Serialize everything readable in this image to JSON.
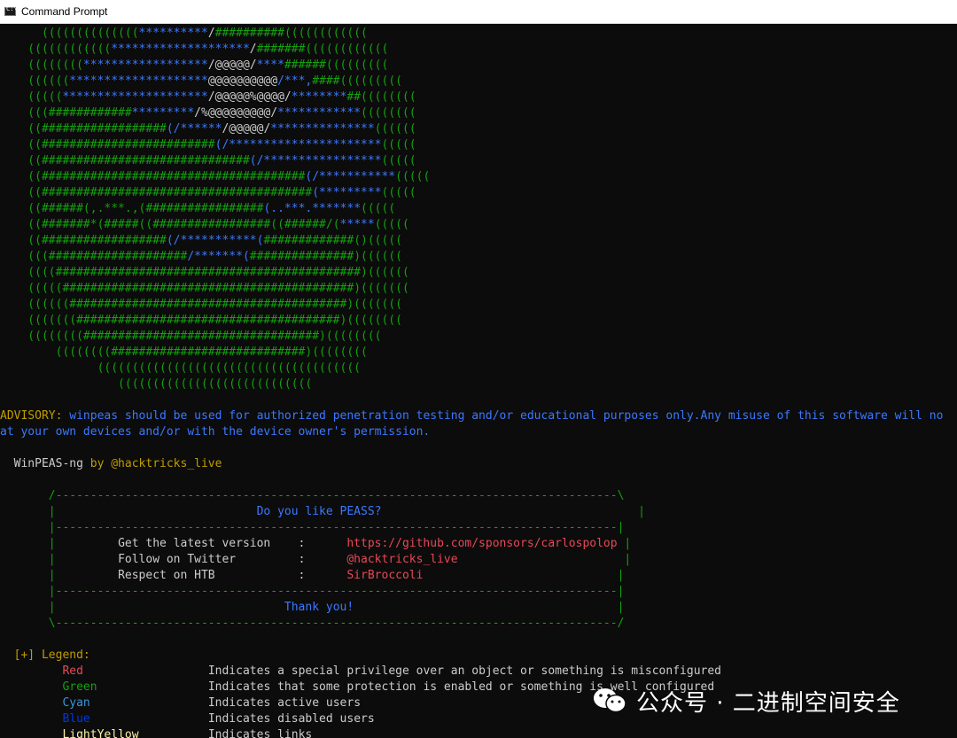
{
  "window": {
    "title": "Command Prompt",
    "icon": "cmd-icon"
  },
  "art": [
    [
      {
        "t": "      ((((((((((((((",
        "c": "g"
      },
      {
        "t": "**********",
        "c": "b"
      },
      {
        "t": "/",
        "c": "w"
      },
      {
        "t": "##########",
        "c": "g"
      },
      {
        "t": "((((((((((((",
        "c": "g"
      }
    ],
    [
      {
        "t": "    ((((((((((((",
        "c": "g"
      },
      {
        "t": "********************",
        "c": "b"
      },
      {
        "t": "/",
        "c": "w"
      },
      {
        "t": "#######",
        "c": "g"
      },
      {
        "t": "((((((((((((",
        "c": "g"
      }
    ],
    [
      {
        "t": "    ((((((((",
        "c": "g"
      },
      {
        "t": "******************",
        "c": "b"
      },
      {
        "t": "/@@@@@/",
        "c": "w"
      },
      {
        "t": "****",
        "c": "b"
      },
      {
        "t": "######",
        "c": "g"
      },
      {
        "t": "(((((((((",
        "c": "g"
      }
    ],
    [
      {
        "t": "    ((((((",
        "c": "g"
      },
      {
        "t": "********************",
        "c": "b"
      },
      {
        "t": "@@@@@@@@@@",
        "c": "w"
      },
      {
        "t": "/***,",
        "c": "b"
      },
      {
        "t": "####",
        "c": "g"
      },
      {
        "t": "(((((((((",
        "c": "g"
      }
    ],
    [
      {
        "t": "    (((((",
        "c": "g"
      },
      {
        "t": "*********************",
        "c": "b"
      },
      {
        "t": "/@@@@@%@@@@/",
        "c": "w"
      },
      {
        "t": "********",
        "c": "b"
      },
      {
        "t": "##",
        "c": "g"
      },
      {
        "t": "((((((((",
        "c": "g"
      }
    ],
    [
      {
        "t": "    (((",
        "c": "g"
      },
      {
        "t": "############",
        "c": "g"
      },
      {
        "t": "*********",
        "c": "b"
      },
      {
        "t": "/%@@@@@@@@@/",
        "c": "w"
      },
      {
        "t": "************",
        "c": "b"
      },
      {
        "t": "((((((((",
        "c": "g"
      }
    ],
    [
      {
        "t": "    ((",
        "c": "g"
      },
      {
        "t": "##################",
        "c": "g"
      },
      {
        "t": "(/******",
        "c": "b"
      },
      {
        "t": "/@@@@@/",
        "c": "w"
      },
      {
        "t": "***************",
        "c": "b"
      },
      {
        "t": "((((((",
        "c": "g"
      }
    ],
    [
      {
        "t": "    ((",
        "c": "g"
      },
      {
        "t": "#########################",
        "c": "g"
      },
      {
        "t": "(/**********************",
        "c": "b"
      },
      {
        "t": "(((((",
        "c": "g"
      }
    ],
    [
      {
        "t": "    ((",
        "c": "g"
      },
      {
        "t": "##############################",
        "c": "g"
      },
      {
        "t": "(/*****************",
        "c": "b"
      },
      {
        "t": "(((((",
        "c": "g"
      }
    ],
    [
      {
        "t": "    ((",
        "c": "g"
      },
      {
        "t": "######################################",
        "c": "g"
      },
      {
        "t": "(/***********",
        "c": "b"
      },
      {
        "t": "(((((",
        "c": "g"
      }
    ],
    [
      {
        "t": "    ((",
        "c": "g"
      },
      {
        "t": "#######################################",
        "c": "g"
      },
      {
        "t": "(*********",
        "c": "b"
      },
      {
        "t": "(((((",
        "c": "g"
      }
    ],
    [
      {
        "t": "    ((",
        "c": "g"
      },
      {
        "t": "######(,.***.,(",
        "c": "g"
      },
      {
        "t": "#################",
        "c": "g"
      },
      {
        "t": "(..***.",
        "c": "b"
      },
      {
        "t": "*******",
        "c": "b"
      },
      {
        "t": "(((((",
        "c": "g"
      }
    ],
    [
      {
        "t": "    ((",
        "c": "g"
      },
      {
        "t": "#######*(#####((",
        "c": "g"
      },
      {
        "t": "#################",
        "c": "g"
      },
      {
        "t": "((######/(",
        "c": "g"
      },
      {
        "t": "*****",
        "c": "b"
      },
      {
        "t": "(((((",
        "c": "g"
      }
    ],
    [
      {
        "t": "    ((",
        "c": "g"
      },
      {
        "t": "##################",
        "c": "g"
      },
      {
        "t": "(/***********(",
        "c": "b"
      },
      {
        "t": "#############",
        "c": "g"
      },
      {
        "t": "()(((((",
        "c": "g"
      }
    ],
    [
      {
        "t": "    (((",
        "c": "g"
      },
      {
        "t": "####################",
        "c": "g"
      },
      {
        "t": "/*******(",
        "c": "b"
      },
      {
        "t": "###############",
        "c": "g"
      },
      {
        "t": ")((((((",
        "c": "g"
      }
    ],
    [
      {
        "t": "    ((((",
        "c": "g"
      },
      {
        "t": "############################################",
        "c": "g"
      },
      {
        "t": ")((((((",
        "c": "g"
      }
    ],
    [
      {
        "t": "    (((((",
        "c": "g"
      },
      {
        "t": "##########################################",
        "c": "g"
      },
      {
        "t": ")(((((((",
        "c": "g"
      }
    ],
    [
      {
        "t": "    ((((((",
        "c": "g"
      },
      {
        "t": "########################################",
        "c": "g"
      },
      {
        "t": ")(((((((",
        "c": "g"
      }
    ],
    [
      {
        "t": "    (((((((",
        "c": "g"
      },
      {
        "t": "######################################",
        "c": "g"
      },
      {
        "t": ")((((((((",
        "c": "g"
      }
    ],
    [
      {
        "t": "    ((((((((",
        "c": "g"
      },
      {
        "t": "##################################",
        "c": "g"
      },
      {
        "t": ")((((((((",
        "c": "g"
      }
    ],
    [
      {
        "t": "        ((((((((",
        "c": "g"
      },
      {
        "t": "############################",
        "c": "g"
      },
      {
        "t": ")((((((((",
        "c": "g"
      }
    ],
    [
      {
        "t": "              ((((((((((((((((((((((((((((((((((((((",
        "c": "g"
      }
    ],
    [
      {
        "t": "                 ((((((((((((((((((((((((((((",
        "c": "g"
      }
    ]
  ],
  "advisory": {
    "label": "ADVISORY:",
    "text1": " winpeas should be used for authorized penetration testing and/or educational purposes only.Any misuse of this software will no",
    "text2": "at your own devices and/or with the device owner's permission."
  },
  "banner": {
    "name": "  WinPEAS-ng",
    "by": " by @hacktricks_live"
  },
  "box": {
    "top": "       /---------------------------------------------------------------------------------\\",
    "question_pre": "       |                             ",
    "question": "Do you like PEASS?",
    "question_post": "                                     |",
    "sep": "       |---------------------------------------------------------------------------------|",
    "rows": [
      {
        "pre": "       |         ",
        "label": "Get the latest version",
        "mid": "    :      ",
        "value": "https://github.com/sponsors/carlospolop",
        "post": " |"
      },
      {
        "pre": "       |         ",
        "label": "Follow on Twitter",
        "mid": "         :      ",
        "value": "@hacktricks_live",
        "post": "                        |"
      },
      {
        "pre": "       |         ",
        "label": "Respect on HTB",
        "mid": "            :      ",
        "value": "SirBroccoli",
        "post": "                            |"
      }
    ],
    "thanks_pre": "       |                                 ",
    "thanks": "Thank you!",
    "thanks_post": "                                      |",
    "bottom": "       \\---------------------------------------------------------------------------------/"
  },
  "legend": {
    "title": "  [+] Legend:",
    "items": [
      {
        "name": "Red",
        "desc": "Indicates a special privilege over an object or something is misconfigured",
        "color": "r"
      },
      {
        "name": "Green",
        "desc": "Indicates that some protection is enabled or something is well configured",
        "color": "dg"
      },
      {
        "name": "Cyan",
        "desc": "Indicates active users",
        "color": "c"
      },
      {
        "name": "Blue",
        "desc": "Indicates disabled users",
        "color": "db"
      },
      {
        "name": "LightYellow",
        "desc": "Indicates links",
        "color": "ly"
      }
    ]
  },
  "watermark": {
    "text": "公众号 · 二进制空间安全",
    "icon": "wechat-icon"
  }
}
